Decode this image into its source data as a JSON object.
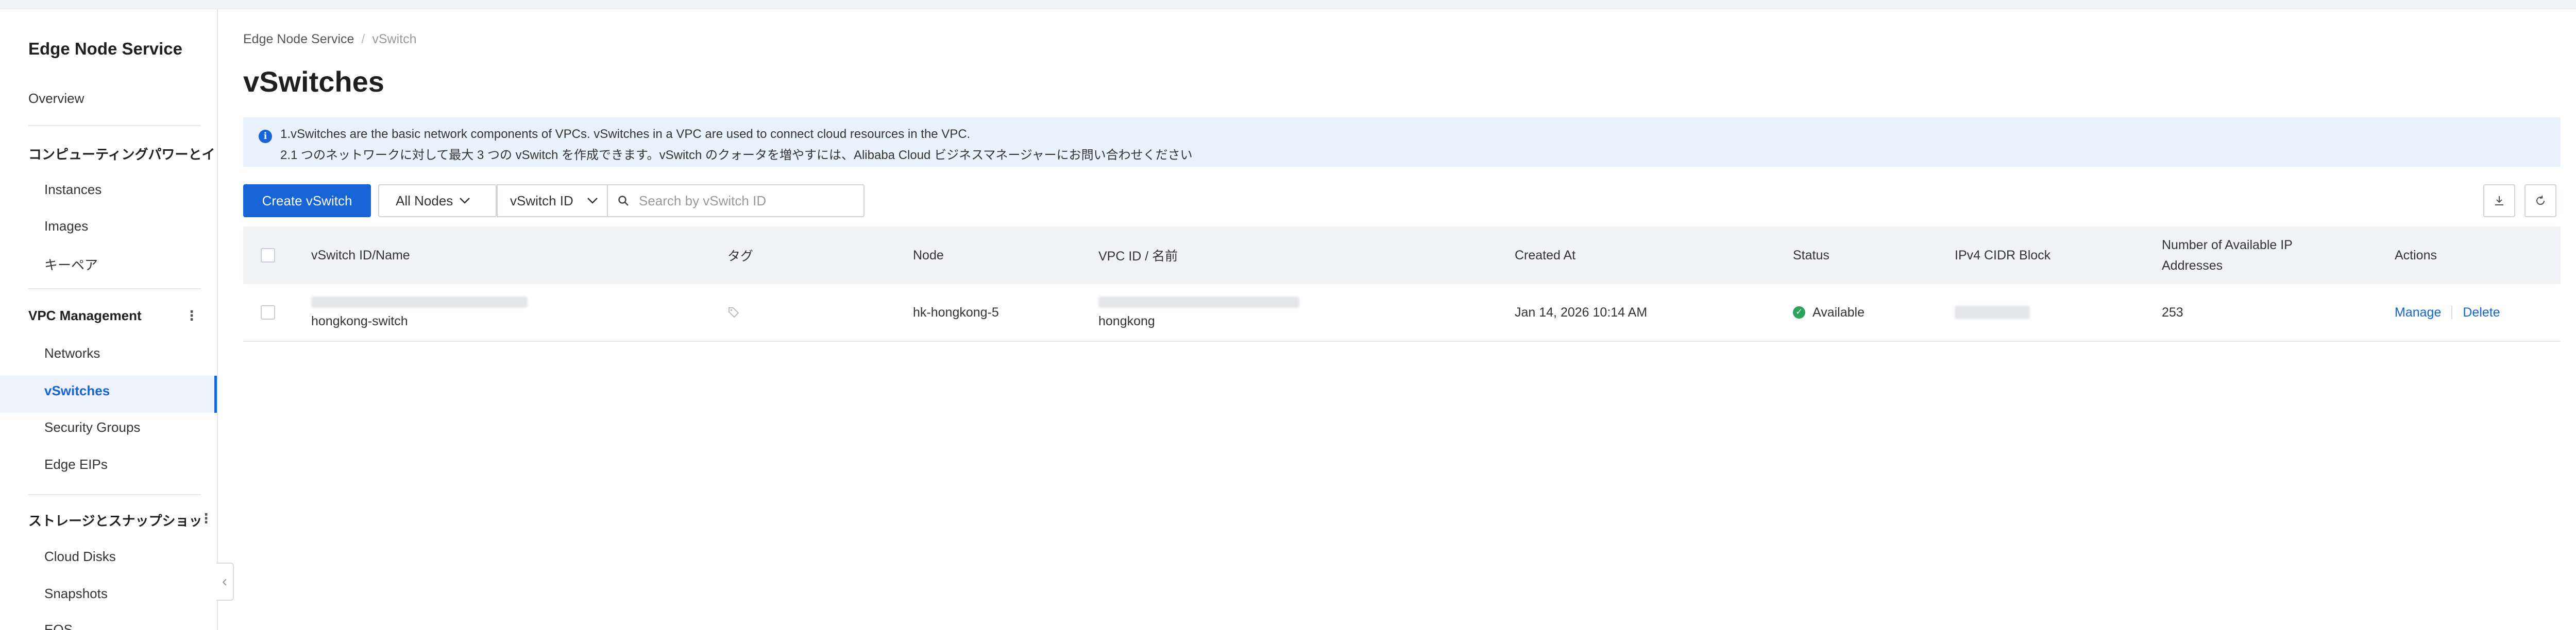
{
  "sidebar": {
    "title": "Edge Node Service",
    "overview": "Overview",
    "group_compute": "コンピューティングパワーとイメージ",
    "compute_items": [
      "Instances",
      "Images",
      "キーペア"
    ],
    "group_vpc": "VPC Management",
    "vpc_items": [
      "Networks",
      "vSwitches",
      "Security Groups",
      "Edge EIPs"
    ],
    "group_storage": "ストレージとスナップショット",
    "storage_items": [
      "Cloud Disks",
      "Snapshots",
      "EOS"
    ]
  },
  "breadcrumb": {
    "root": "Edge Node Service",
    "separator": "/",
    "current": "vSwitch"
  },
  "page": {
    "title": "vSwitches"
  },
  "notice": {
    "line1": "1.vSwitches are the basic network components of VPCs. vSwitches in a VPC are used to connect cloud resources in the VPC.",
    "line2": "2.1 つのネットワークに対して最大 3 つの vSwitch を作成できます。vSwitch のクォータを増やすには、Alibaba Cloud ビジネスマネージャーにお問い合わせください"
  },
  "toolbar": {
    "create_label": "Create vSwitch",
    "node_filter": "All Nodes",
    "search_field": "vSwitch ID",
    "search_placeholder": "Search by vSwitch ID"
  },
  "table": {
    "headers": {
      "id_name": "vSwitch ID/Name",
      "tag": "タグ",
      "node": "Node",
      "vpc": "VPC ID / 名前",
      "created": "Created At",
      "status": "Status",
      "cidr": "IPv4 CIDR Block",
      "available_ip_line1": "Number of Available IP",
      "available_ip_line2": "Addresses",
      "actions": "Actions"
    },
    "rows": [
      {
        "name": "hongkong-switch",
        "node": "hk-hongkong-5",
        "vpc_name": "hongkong",
        "created": "Jan 14, 2026 10:14 AM",
        "status": "Available",
        "available_ips": "253",
        "action_manage": "Manage",
        "action_delete": "Delete"
      }
    ]
  },
  "colors": {
    "primary": "#1764d6",
    "notice_bg": "#e8f2fd",
    "success": "#2ea45b",
    "header_bg": "#f0f2f5"
  },
  "icons": {
    "info": "info-icon",
    "search": "search-icon",
    "download": "download-icon",
    "refresh": "refresh-icon",
    "tag": "tag-icon",
    "status": "check-circle-icon",
    "collapse": "chevron-left-icon",
    "dropdown": "chevron-down-icon",
    "more": "kebab-icon"
  }
}
